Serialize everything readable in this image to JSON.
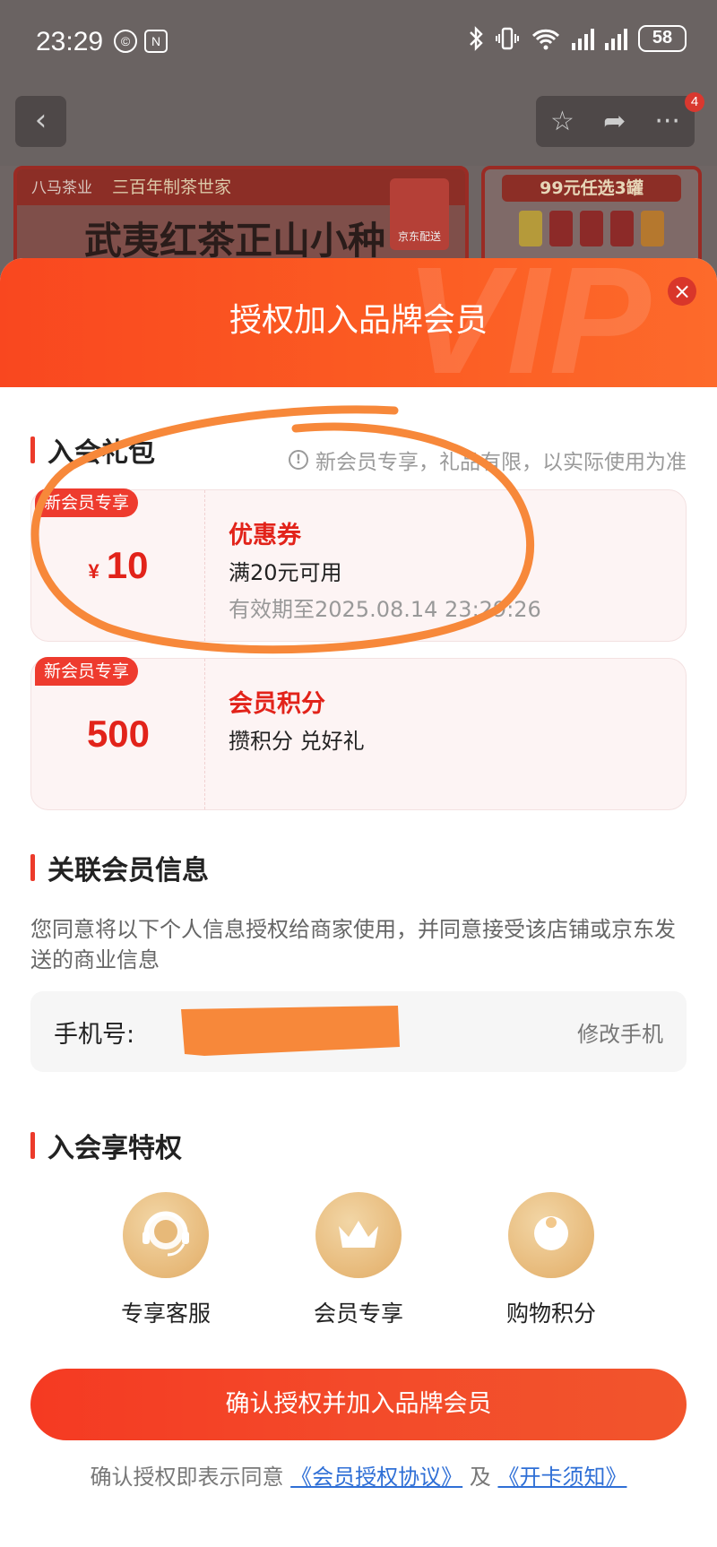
{
  "status_bar": {
    "time": "23:29",
    "icon_left_1": "©",
    "icon_left_2": "N",
    "battery": "58"
  },
  "background_page": {
    "badge_count": "4",
    "banner1": {
      "brand": "八马茶业",
      "slogan": "三百年制茶世家",
      "title": "武夷红茶正山小种",
      "seal": "京东配送"
    },
    "banner2": {
      "title": "99元任选3罐"
    }
  },
  "modal": {
    "title": "授权加入品牌会员",
    "watermark": "VIP",
    "close_label": "×",
    "gift_section": {
      "title": "入会礼包",
      "note": "新会员专享，礼品有限，以实际使用为准",
      "cards": [
        {
          "tag": "新会员专享",
          "currency": "¥",
          "value": "10",
          "title": "优惠券",
          "desc": "满20元可用",
          "expiry": "有效期至2025.08.14 23:29:26"
        },
        {
          "tag": "新会员专享",
          "currency": "",
          "value": "500",
          "title": "会员积分",
          "desc": "攒积分 兑好礼",
          "expiry": ""
        }
      ]
    },
    "assoc_section": {
      "title": "关联会员信息",
      "desc": "您同意将以下个人信息授权给商家使用，并同意接受该店铺或京东发送的商业信息",
      "phone_label": "手机号:",
      "change_label": "修改手机"
    },
    "privileges_section": {
      "title": "入会享特权",
      "items": [
        {
          "label": "专享客服",
          "icon": "headset-icon"
        },
        {
          "label": "会员专享",
          "icon": "crown-icon"
        },
        {
          "label": "购物积分",
          "icon": "coin-icon"
        }
      ]
    },
    "confirm_button": "确认授权并加入品牌会员",
    "agreement": {
      "prefix": "确认授权即表示同意",
      "link1": "《会员授权协议》",
      "and": "及",
      "link2": "《开卡须知》"
    }
  },
  "colors": {
    "accent": "#f53a22",
    "price_red": "#e2231a",
    "gold": "#e7b979",
    "annotation_orange": "#f7883a"
  }
}
